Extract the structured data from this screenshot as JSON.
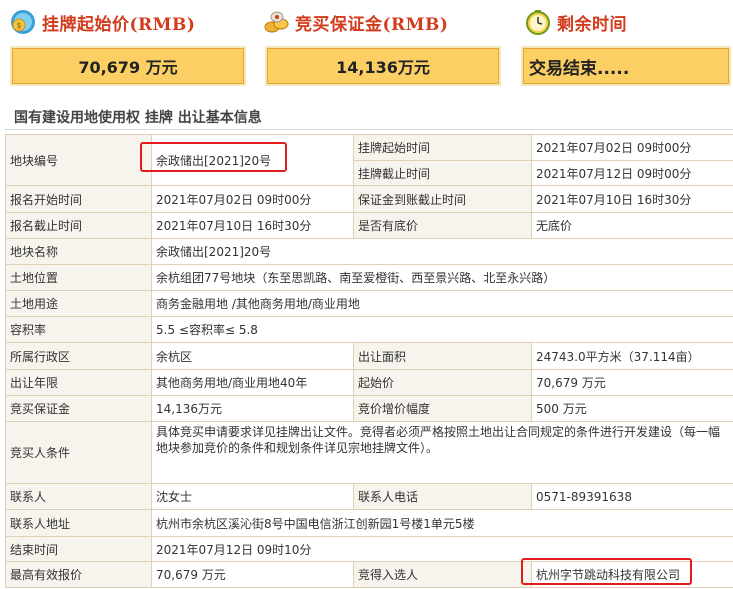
{
  "top": {
    "listing_price": {
      "label": "挂牌起始价(RMB)",
      "value": "70,679 万元",
      "icon": "money-bag-icon"
    },
    "deposit": {
      "label": "竞买保证金(RMB)",
      "value": "14,136万元",
      "icon": "coins-icon"
    },
    "remaining_time": {
      "label": "剩余时间",
      "value": "交易结束.....",
      "icon": "clock-icon"
    }
  },
  "section_title": "国有建设用地使用权 挂牌 出让基本信息",
  "rows": {
    "plot_no": {
      "label": "地块编号",
      "value": "余政储出[2021]20号"
    },
    "listing_start": {
      "label": "挂牌起始时间",
      "value": "2021年07月02日 09时00分"
    },
    "listing_end": {
      "label": "挂牌截止时间",
      "value": "2021年07月12日 09时00分"
    },
    "reg_start": {
      "label": "报名开始时间",
      "value": "2021年07月02日 09时00分"
    },
    "deposit_deadline": {
      "label": "保证金到账截止时间",
      "value": "2021年07月10日 16时30分"
    },
    "reg_end": {
      "label": "报名截止时间",
      "value": "2021年07月10日 16时30分"
    },
    "reserve_price": {
      "label": "是否有底价",
      "value": "无底价"
    },
    "plot_name": {
      "label": "地块名称",
      "value": "余政储出[2021]20号"
    },
    "location": {
      "label": "土地位置",
      "value": "余杭组团77号地块（东至思凯路、南至爱橙街、西至景兴路、北至永兴路）"
    },
    "land_use": {
      "label": "土地用途",
      "value": "商务金融用地 /其他商务用地/商业用地"
    },
    "plot_ratio": {
      "label": "容积率",
      "value": "5.5 ≤容积率≤ 5.8"
    },
    "district": {
      "label": "所属行政区",
      "value": "余杭区"
    },
    "area": {
      "label": "出让面积",
      "value": "24743.0平方米（37.114亩）"
    },
    "term": {
      "label": "出让年限",
      "value": "其他商务用地/商业用地40年"
    },
    "start_price": {
      "label": "起始价",
      "value": "70,679 万元"
    },
    "bid_deposit": {
      "label": "竞买保证金",
      "value": "14,136万元"
    },
    "increment": {
      "label": "竞价增价幅度",
      "value": "500 万元"
    },
    "conditions": {
      "label": "竞买人条件",
      "value": "具体竞买申请要求详见挂牌出让文件。竞得者必须严格按照土地出让合同规定的条件进行开发建设（每一幅地块参加竞价的条件和规划条件详见宗地挂牌文件）。"
    },
    "contact": {
      "label": "联系人",
      "value": "沈女士"
    },
    "phone": {
      "label": "联系人电话",
      "value": "0571-89391638"
    },
    "address": {
      "label": "联系人地址",
      "value": "杭州市余杭区溪沁街8号中国电信浙江创新园1号楼1单元5楼"
    },
    "end_time": {
      "label": "结束时间",
      "value": "2021年07月12日 09时10分"
    },
    "highest_bid": {
      "label": "最高有效报价",
      "value": "70,679 万元"
    },
    "winner": {
      "label": "竞得入选人",
      "value": "杭州字节跳动科技有限公司"
    }
  },
  "colors": {
    "header_text": "#d23b1c",
    "value_box": "#fbcf63",
    "highlight_box": "#e21c1c",
    "label_cell": "#f7f4ee",
    "table_border": "#e0d0b8"
  }
}
